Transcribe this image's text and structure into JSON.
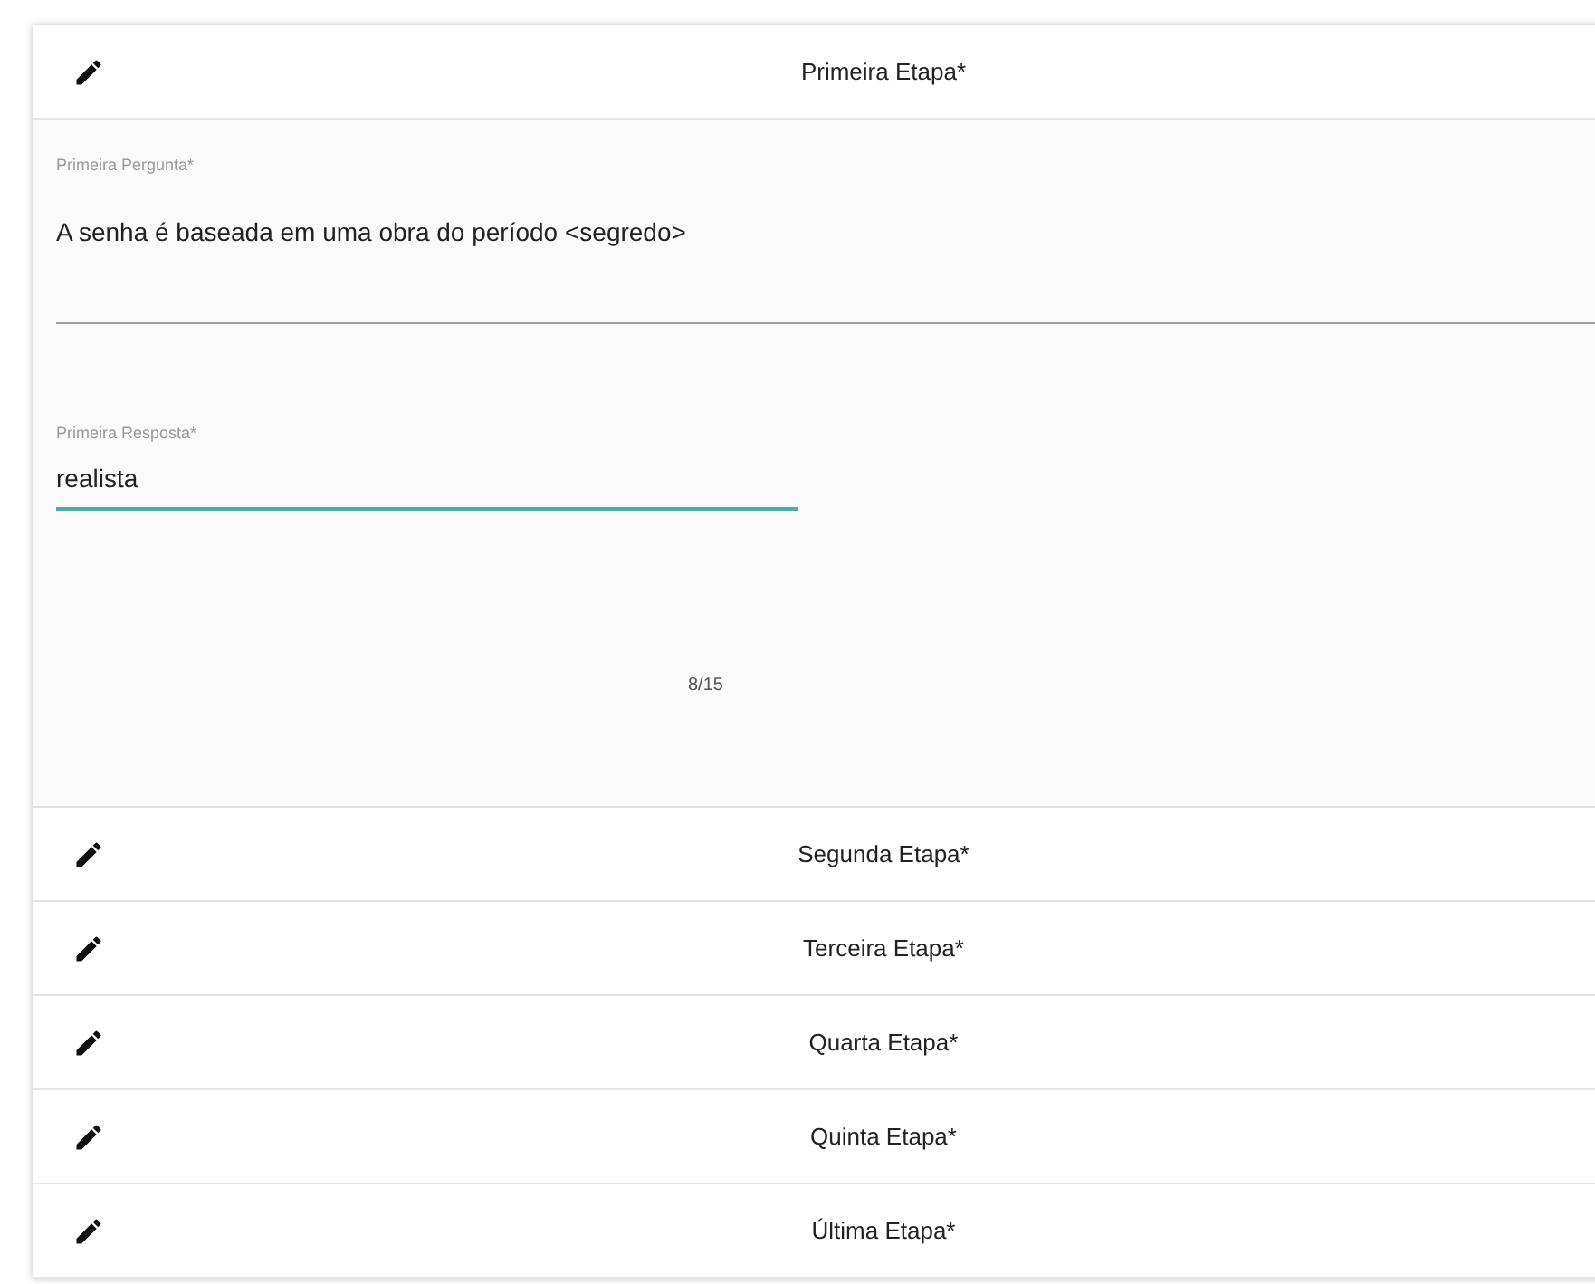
{
  "steps": [
    {
      "title": "Primeira Etapa*",
      "question": {
        "label": "Primeira Pergunta*",
        "value": "A senha é baseada em uma obra do período <segredo>"
      },
      "answer": {
        "label": "Primeira Resposta*",
        "value": "realista",
        "focused": true
      },
      "counter": "8/15"
    },
    {
      "title": "Segunda Etapa*"
    },
    {
      "title": "Terceira Etapa*"
    },
    {
      "title": "Quarta Etapa*"
    },
    {
      "title": "Quinta Etapa*"
    },
    {
      "title": "Última Etapa*"
    }
  ]
}
